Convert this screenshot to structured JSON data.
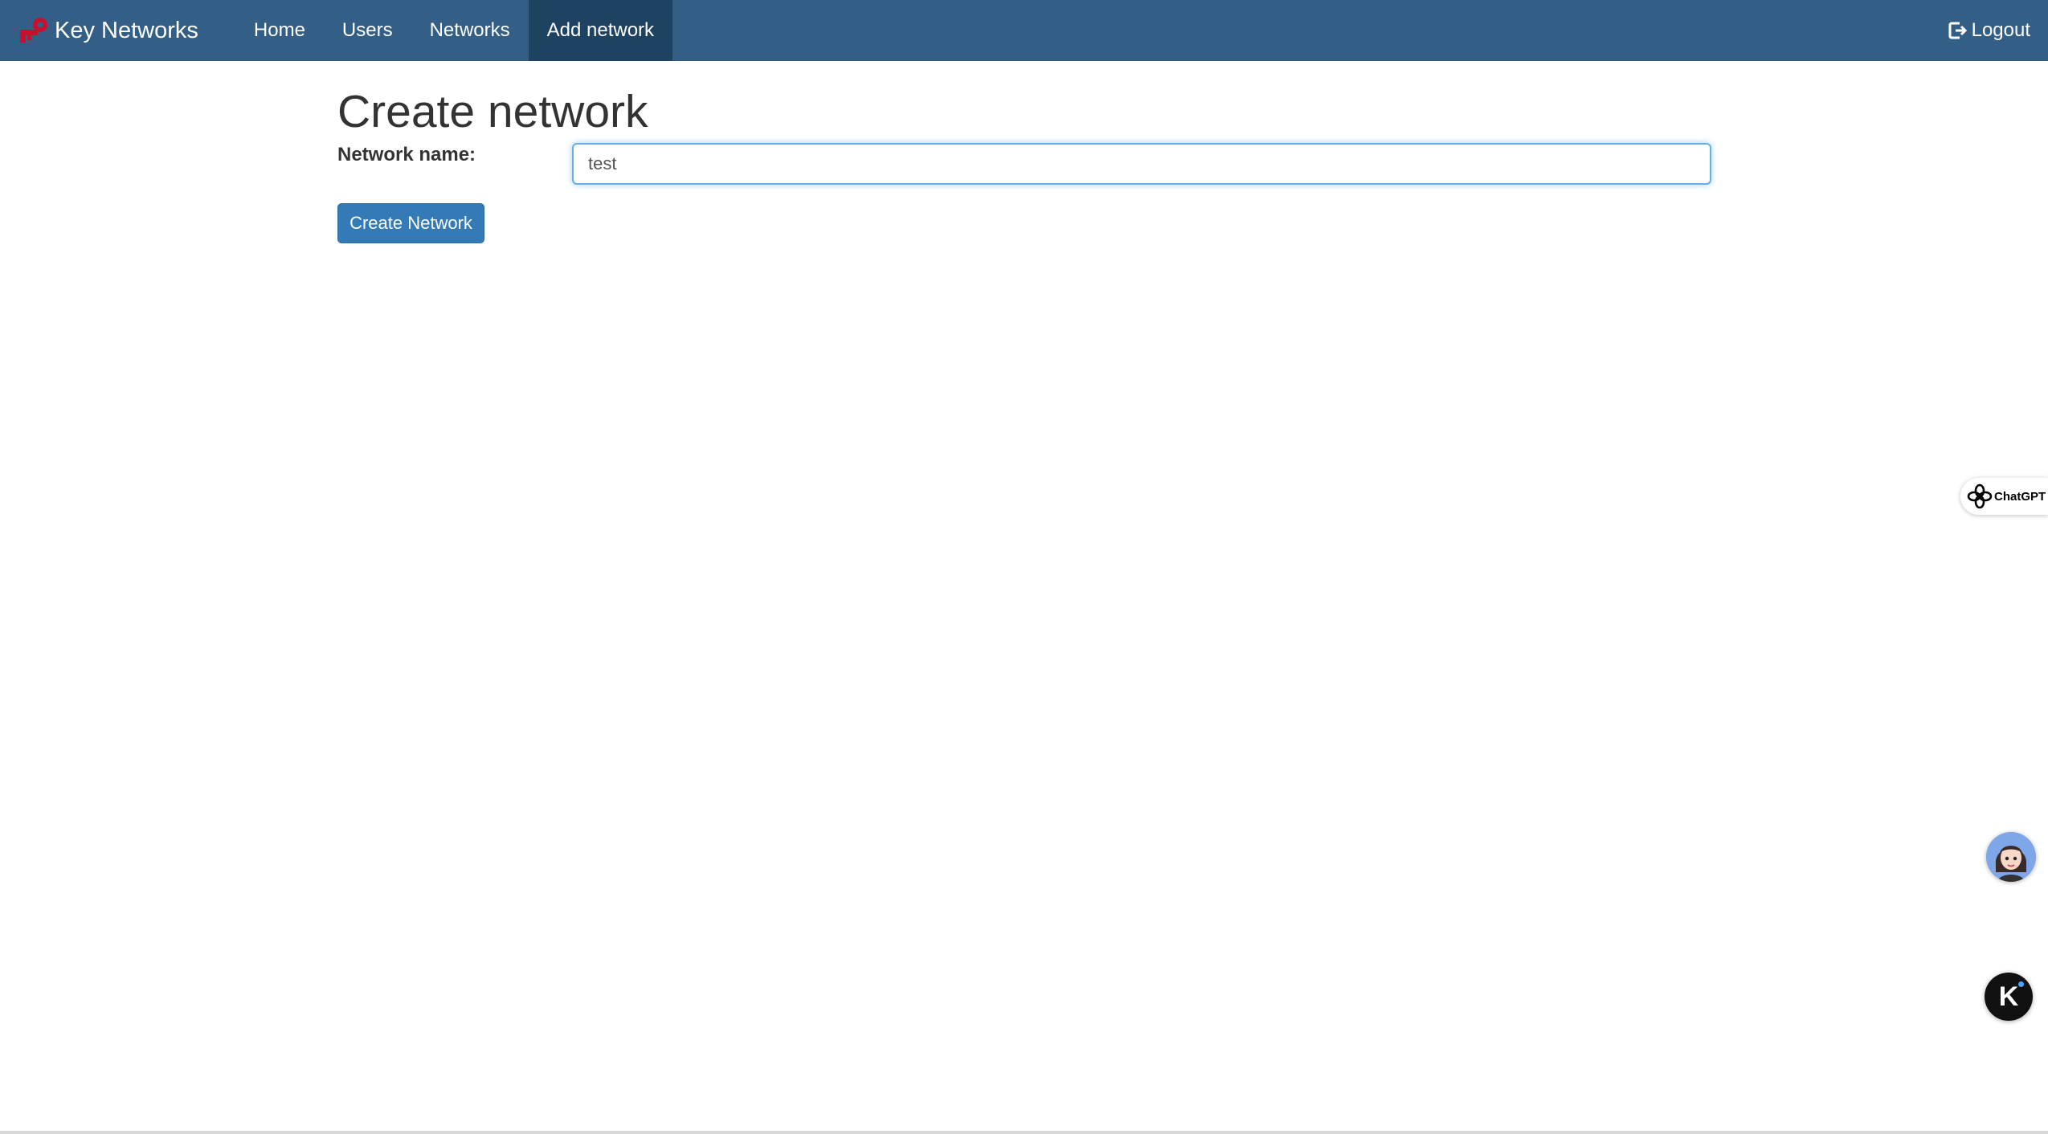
{
  "navbar": {
    "brand": "Key Networks",
    "items": [
      {
        "label": "Home",
        "active": false
      },
      {
        "label": "Users",
        "active": false
      },
      {
        "label": "Networks",
        "active": false
      },
      {
        "label": "Add network",
        "active": true
      }
    ],
    "logout_label": "Logout"
  },
  "main": {
    "title": "Create network",
    "form": {
      "name_label": "Network name:",
      "name_value": "test",
      "submit_label": "Create Network"
    }
  },
  "widgets": {
    "chatgpt_label": "ChatGPT",
    "k_label": "K"
  },
  "colors": {
    "navbar_bg": "#335f87",
    "navbar_active_bg": "#1e4262",
    "primary_button": "#337ab7",
    "input_focus_border": "#66afe9",
    "brand_icon": "#c8102e"
  },
  "icons": {
    "brand": "key-icon",
    "logout": "logout-icon",
    "chatgpt": "chatgpt-logo-icon",
    "assistant": "avatar-icon"
  }
}
